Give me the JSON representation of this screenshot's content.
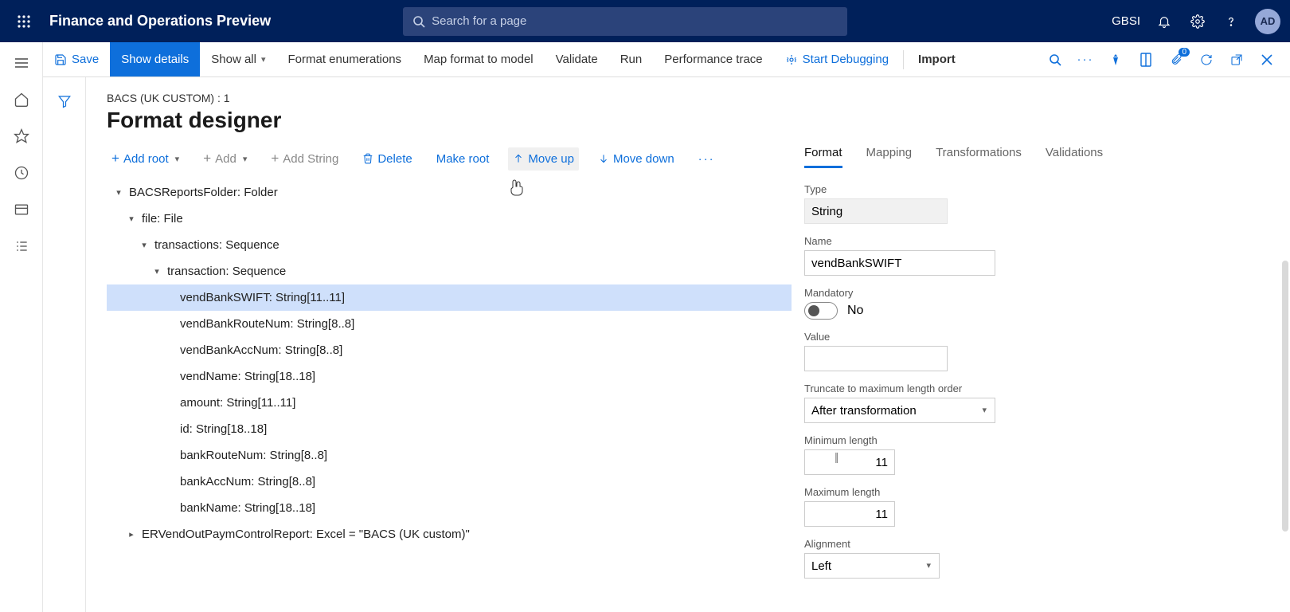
{
  "header": {
    "app_title": "Finance and Operations Preview",
    "search_placeholder": "Search for a page",
    "org": "GBSI",
    "avatar": "AD"
  },
  "toolbar": {
    "save": "Save",
    "show_details": "Show details",
    "show_all": "Show all",
    "format_enum": "Format enumerations",
    "map": "Map format to model",
    "validate": "Validate",
    "run": "Run",
    "perf": "Performance trace",
    "start_debug": "Start Debugging",
    "import": "Import",
    "attach_badge": "0"
  },
  "page": {
    "breadcrumb": "BACS (UK CUSTOM) : 1",
    "title": "Format designer"
  },
  "designer_toolbar": {
    "add_root": "Add root",
    "add": "Add",
    "add_string": "Add String",
    "delete": "Delete",
    "make_root": "Make root",
    "move_up": "Move up",
    "move_down": "Move down"
  },
  "tree": {
    "n0": "BACSReportsFolder: Folder",
    "n1": "file: File",
    "n2": "transactions: Sequence",
    "n3": "transaction: Sequence",
    "n4": "vendBankSWIFT: String[11..11]",
    "n5": "vendBankRouteNum: String[8..8]",
    "n6": "vendBankAccNum: String[8..8]",
    "n7": "vendName: String[18..18]",
    "n8": "amount: String[11..11]",
    "n9": "id: String[18..18]",
    "n10": "bankRouteNum: String[8..8]",
    "n11": "bankAccNum: String[8..8]",
    "n12": "bankName: String[18..18]",
    "n13": "ERVendOutPaymControlReport: Excel = \"BACS (UK custom)\""
  },
  "tabs": {
    "format": "Format",
    "mapping": "Mapping",
    "trans": "Transformations",
    "valid": "Validations"
  },
  "props": {
    "type_label": "Type",
    "type_value": "String",
    "name_label": "Name",
    "name_value": "vendBankSWIFT",
    "mandatory_label": "Mandatory",
    "mandatory_value": "No",
    "value_label": "Value",
    "value_value": "",
    "truncate_label": "Truncate to maximum length order",
    "truncate_value": "After transformation",
    "min_label": "Minimum length",
    "min_value": "11",
    "max_label": "Maximum length",
    "max_value": "11",
    "align_label": "Alignment",
    "align_value": "Left"
  }
}
